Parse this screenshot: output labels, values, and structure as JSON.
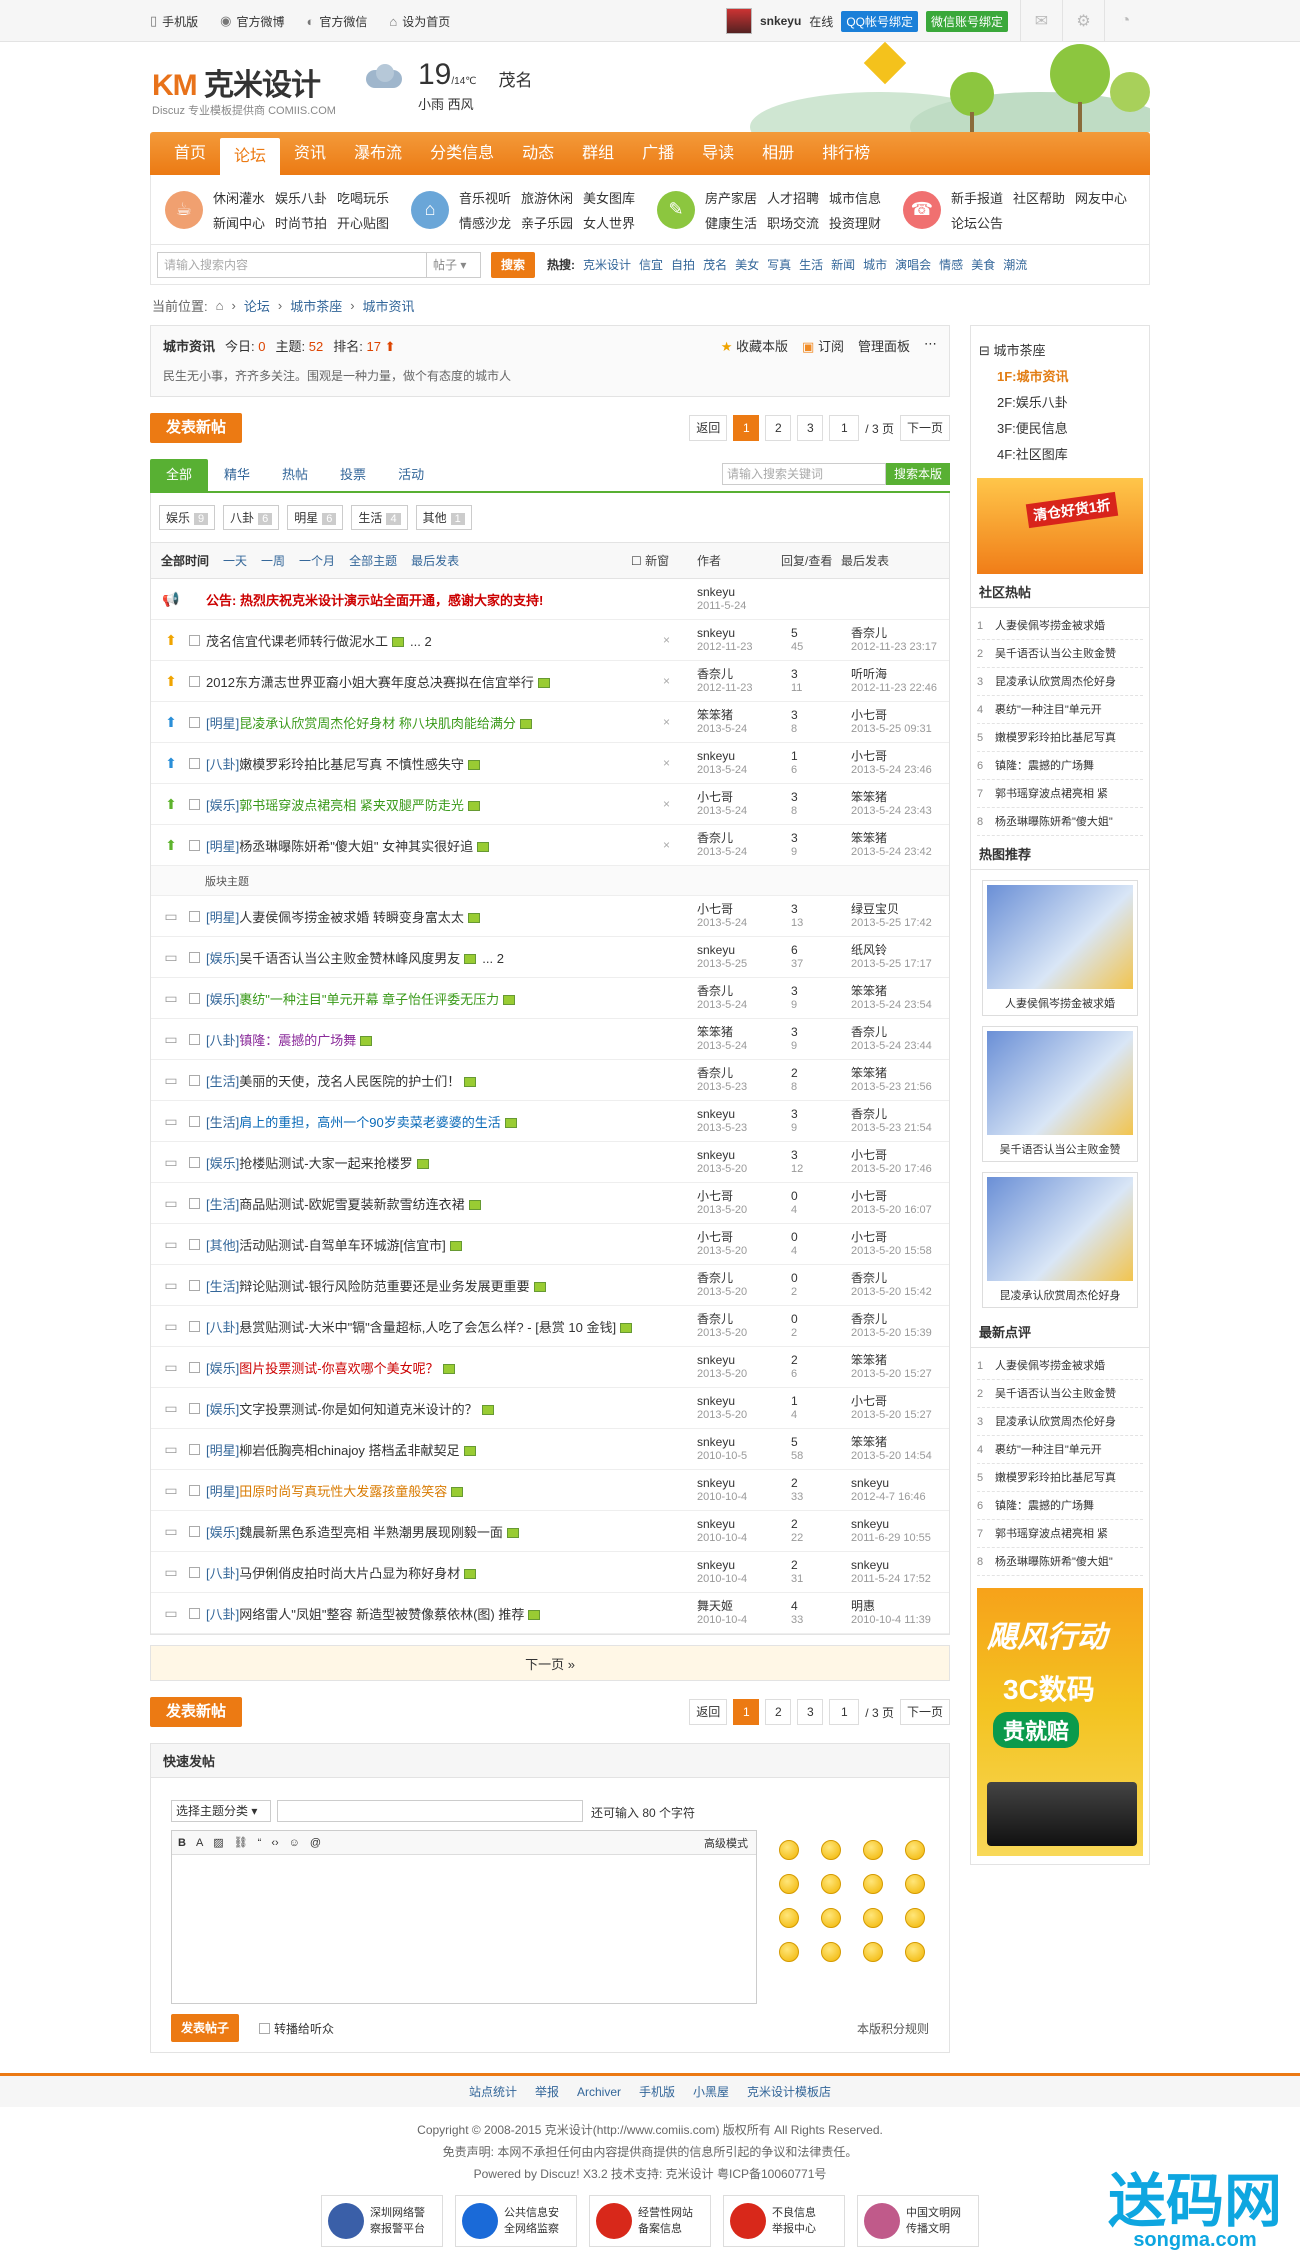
{
  "topbar": {
    "links": [
      "手机版",
      "官方微博",
      "官方微信",
      "设为首页"
    ],
    "user": "snkeyu",
    "status": "在线",
    "qq": "QQ帐号绑定",
    "wx": "微信账号绑定"
  },
  "logo": {
    "brand": "克米设计",
    "sub": "Discuz 专业模板提供商 COMIIS.COM"
  },
  "weather": {
    "temp": "19",
    "range": "/14℃",
    "city": "茂名",
    "desc": "小雨  西风"
  },
  "nav": [
    "首页",
    "论坛",
    "资讯",
    "瀑布流",
    "分类信息",
    "动态",
    "群组",
    "广播",
    "导读",
    "相册",
    "排行榜"
  ],
  "quick": [
    {
      "links": [
        "休闲灌水",
        "娱乐八卦",
        "吃喝玩乐",
        "新闻中心",
        "时尚节拍",
        "开心贴图"
      ],
      "color": "#f0a070"
    },
    {
      "links": [
        "音乐视听",
        "旅游休闲",
        "美女图库",
        "情感沙龙",
        "亲子乐园",
        "女人世界"
      ],
      "color": "#6aa6d8"
    },
    {
      "links": [
        "房产家居",
        "人才招聘",
        "城市信息",
        "健康生活",
        "职场交流",
        "投资理财"
      ],
      "color": "#8cc63f"
    },
    {
      "links": [
        "新手报道",
        "社区帮助",
        "网友中心",
        "论坛公告"
      ],
      "color": "#f07070"
    }
  ],
  "search": {
    "placeholder": "请输入搜索内容",
    "type": "帖子",
    "button": "搜索",
    "hot_label": "热搜:",
    "hot": [
      "克米设计",
      "信宜",
      "自拍",
      "茂名",
      "美女",
      "写真",
      "生活",
      "新闻",
      "城市",
      "演唱会",
      "情感",
      "美食",
      "潮流"
    ]
  },
  "crumb": {
    "label": "当前位置:",
    "items": [
      "论坛",
      "城市茶座",
      "城市资讯"
    ]
  },
  "forum": {
    "name": "城市资讯",
    "today_label": "今日:",
    "today": "0",
    "topics_label": "主题:",
    "topics": "52",
    "rank_label": "排名:",
    "rank": "17",
    "fav": "收藏本版",
    "rss": "订阅",
    "admin": "管理面板",
    "desc": "民生无小事，齐齐多关注。围观是一种力量，做个有态度的城市人"
  },
  "pager": {
    "post": "发表新帖",
    "back": "返回",
    "pages": [
      "1",
      "2",
      "3"
    ],
    "current": "1",
    "total": "/ 3 页",
    "next": "下一页"
  },
  "tabs": {
    "items": [
      "全部",
      "精华",
      "热帖",
      "投票",
      "活动"
    ],
    "search_placeholder": "请输入搜索关键词",
    "search_btn": "搜索本版"
  },
  "types": [
    {
      "name": "娱乐",
      "n": "9"
    },
    {
      "name": "八卦",
      "n": "6"
    },
    {
      "name": "明星",
      "n": "6"
    },
    {
      "name": "生活",
      "n": "4"
    },
    {
      "name": "其他",
      "n": "1"
    }
  ],
  "thead": {
    "sorts": [
      "全部时间",
      "一天",
      "一周",
      "一个月",
      "全部主题",
      "最后发表"
    ],
    "newwin": "新窗",
    "author": "作者",
    "reply": "回复/查看",
    "last": "最后发表"
  },
  "sep": "版块主题",
  "threads": [
    {
      "t": "公告: 热烈庆祝克米设计演示站全面开通，感谢大家的支持!",
      "a": "snkeyu",
      "ad": "2011-5-24",
      "r": "",
      "v": "",
      "l": "",
      "ld": "",
      "ann": true
    },
    {
      "t": "茂名信宜代课老师转行做泥水工",
      "a": "snkeyu",
      "ad": "2012-11-23",
      "r": "5",
      "v": "45",
      "l": "香奈儿",
      "ld": "2012-11-23 23:17",
      "pg": "... 2"
    },
    {
      "t": "2012东方潇志世界亚裔小姐大赛年度总决赛拟在信宜举行",
      "a": "香奈儿",
      "ad": "2012-11-23",
      "r": "3",
      "v": "11",
      "l": "听听海",
      "ld": "2012-11-23 22:46"
    },
    {
      "c": "[明星]",
      "t": "昆凌承认欣赏周杰伦好身材 称八块肌肉能给满分",
      "a": "笨笨猪",
      "ad": "2013-5-24",
      "r": "3",
      "v": "8",
      "l": "小七哥",
      "ld": "2013-5-25 09:31",
      "green": true
    },
    {
      "c": "[八卦]",
      "t": "嫩模罗彩玲拍比基尼写真 不慎性感失守",
      "a": "snkeyu",
      "ad": "2013-5-24",
      "r": "1",
      "v": "6",
      "l": "小七哥",
      "ld": "2013-5-24 23:46"
    },
    {
      "c": "[娱乐]",
      "t": "郭书瑶穿波点裙亮相 紧夹双腿严防走光",
      "a": "小七哥",
      "ad": "2013-5-24",
      "r": "3",
      "v": "8",
      "l": "笨笨猪",
      "ld": "2013-5-24 23:43",
      "green": true
    },
    {
      "c": "[明星]",
      "t": "杨丞琳曝陈妍希\"傻大姐\" 女神其实很好追",
      "a": "香奈儿",
      "ad": "2013-5-24",
      "r": "3",
      "v": "9",
      "l": "笨笨猪",
      "ld": "2013-5-24 23:42"
    },
    {
      "sep": true
    },
    {
      "c": "[明星]",
      "t": "人妻侯佩岑捞金被求婚 转瞬变身富太太",
      "a": "小七哥",
      "ad": "2013-5-24",
      "r": "3",
      "v": "13",
      "l": "绿豆宝贝",
      "ld": "2013-5-25 17:42"
    },
    {
      "c": "[娱乐]",
      "t": "吴千语否认当公主败金赞林峰风度男友",
      "a": "snkeyu",
      "ad": "2013-5-25",
      "r": "6",
      "v": "37",
      "l": "纸风铃",
      "ld": "2013-5-25 17:17",
      "pg": "... 2"
    },
    {
      "c": "[娱乐]",
      "t": "裹纺\"一种注目\"单元开幕 章子怡任评委无压力",
      "a": "香奈儿",
      "ad": "2013-5-24",
      "r": "3",
      "v": "9",
      "l": "笨笨猪",
      "ld": "2013-5-24 23:54",
      "green": true
    },
    {
      "c": "[八卦]",
      "t": "镇隆：震撼的广场舞",
      "a": "笨笨猪",
      "ad": "2013-5-24",
      "r": "3",
      "v": "9",
      "l": "香奈儿",
      "ld": "2013-5-24 23:44",
      "purple": true
    },
    {
      "c": "[生活]",
      "t": "美丽的天使，茂名人民医院的护士们！",
      "a": "香奈儿",
      "ad": "2013-5-23",
      "r": "2",
      "v": "8",
      "l": "笨笨猪",
      "ld": "2013-5-23 21:56"
    },
    {
      "c": "[生活]",
      "t": "肩上的重担，高州一个90岁卖菜老婆婆的生活",
      "a": "snkeyu",
      "ad": "2013-5-23",
      "r": "3",
      "v": "9",
      "l": "香奈儿",
      "ld": "2013-5-23 21:54",
      "blue": true
    },
    {
      "c": "[娱乐]",
      "t": "抢楼贴测试-大家一起来抢楼罗",
      "a": "snkeyu",
      "ad": "2013-5-20",
      "r": "3",
      "v": "12",
      "l": "小七哥",
      "ld": "2013-5-20 17:46"
    },
    {
      "c": "[生活]",
      "t": "商品贴测试-欧妮雪夏装新款雪纺连衣裙",
      "a": "小七哥",
      "ad": "2013-5-20",
      "r": "0",
      "v": "4",
      "l": "小七哥",
      "ld": "2013-5-20 16:07"
    },
    {
      "c": "[其他]",
      "t": "活动贴测试-自驾单车环城游[信宜市]",
      "a": "小七哥",
      "ad": "2013-5-20",
      "r": "0",
      "v": "4",
      "l": "小七哥",
      "ld": "2013-5-20 15:58"
    },
    {
      "c": "[生活]",
      "t": "辩论贴测试-银行风险防范重要还是业务发展更重要",
      "a": "香奈儿",
      "ad": "2013-5-20",
      "r": "0",
      "v": "2",
      "l": "香奈儿",
      "ld": "2013-5-20 15:42"
    },
    {
      "c": "[八卦]",
      "t": "悬赏贴测试-大米中\"镉\"含量超标,人吃了会怎么样? - [悬赏 10 金钱]",
      "a": "香奈儿",
      "ad": "2013-5-20",
      "r": "0",
      "v": "2",
      "l": "香奈儿",
      "ld": "2013-5-20 15:39"
    },
    {
      "c": "[娱乐]",
      "t": "图片投票测试-你喜欢哪个美女呢？",
      "a": "snkeyu",
      "ad": "2013-5-20",
      "r": "2",
      "v": "6",
      "l": "笨笨猪",
      "ld": "2013-5-20 15:27",
      "red": true
    },
    {
      "c": "[娱乐]",
      "t": "文字投票测试-你是如何知道克米设计的？",
      "a": "snkeyu",
      "ad": "2013-5-20",
      "r": "1",
      "v": "4",
      "l": "小七哥",
      "ld": "2013-5-20 15:27"
    },
    {
      "c": "[明星]",
      "t": "柳岩低胸亮相chinajoy 搭档孟非献契足",
      "a": "snkeyu",
      "ad": "2010-10-5",
      "r": "5",
      "v": "58",
      "l": "笨笨猪",
      "ld": "2013-5-20 14:54"
    },
    {
      "c": "[明星]",
      "t": "田原时尚写真玩性大发露孩童般笑容",
      "a": "snkeyu",
      "ad": "2010-10-4",
      "r": "2",
      "v": "33",
      "l": "snkeyu",
      "ld": "2012-4-7 16:46",
      "orange": true
    },
    {
      "c": "[娱乐]",
      "t": "魏晨新黑色系造型亮相 半熟潮男展现刚毅一面",
      "a": "snkeyu",
      "ad": "2010-10-4",
      "r": "2",
      "v": "22",
      "l": "snkeyu",
      "ld": "2011-6-29 10:55"
    },
    {
      "c": "[八卦]",
      "t": "马伊俐俏皮拍时尚大片凸显为称好身材",
      "a": "snkeyu",
      "ad": "2010-10-4",
      "r": "2",
      "v": "31",
      "l": "snkeyu",
      "ld": "2011-5-24 17:52"
    },
    {
      "c": "[八卦]",
      "t": "网络雷人\"凤姐\"整容 新造型被赞像蔡依林(图) 推荐",
      "a": "舞天姬",
      "ad": "2010-10-4",
      "r": "4",
      "v": "33",
      "l": "明惠",
      "ld": "2010-10-4 11:39"
    }
  ],
  "nextpage": "下一页 »",
  "quickpost": {
    "title": "快速发帖",
    "sel": "选择主题分类",
    "limit": "还可输入 80 个字符",
    "adv": "高级模式",
    "submit": "发表帖子",
    "sync": "转播给听众",
    "rule": "本版积分规则"
  },
  "right": {
    "tree": {
      "root": "城市茶座",
      "items": [
        "1F:城市资讯",
        "2F:娱乐八卦",
        "3F:便民信息",
        "4F:社区图库"
      ]
    },
    "ad1": "清仓好货1折",
    "hot_title": "社区热帖",
    "hot": [
      "人妻侯佩岑捞金被求婚",
      "吴千语否认当公主败金赞",
      "昆凌承认欣赏周杰伦好身",
      "裹纺\"一种注目\"单元开",
      "嫩模罗彩玲拍比基尼写真",
      "镇隆：震撼的广场舞",
      "郭书瑶穿波点裙亮相 紧",
      "杨丞琳曝陈妍希\"傻大姐\""
    ],
    "rec_title": "热图推荐",
    "pics": [
      "人妻侯佩岑捞金被求婚",
      "吴千语否认当公主败金赞",
      "昆凌承认欣赏周杰伦好身"
    ],
    "cmt_title": "最新点评",
    "cmt": [
      "人妻侯佩岑捞金被求婚",
      "吴千语否认当公主败金赞",
      "昆凌承认欣赏周杰伦好身",
      "裹纺\"一种注目\"单元开",
      "嫩模罗彩玲拍比基尼写真",
      "镇隆：震撼的广场舞",
      "郭书瑶穿波点裙亮相 紧",
      "杨丞琳曝陈妍希\"傻大姐\""
    ],
    "ad2": {
      "t1": "飓风行动",
      "t2": "3C数码",
      "t3": "贵就赔"
    }
  },
  "footer": {
    "links": [
      "站点统计",
      "举报",
      "Archiver",
      "手机版",
      "小黑屋",
      "克米设计模板店"
    ],
    "lines": [
      "Copyright © 2008-2015 克米设计(http://www.comiis.com) 版权所有 All Rights Reserved.",
      "免责声明: 本网不承担任何由内容提供商提供的信息所引起的争议和法律责任。",
      "Powered by Discuz! X3.2  技术支持: 克米设计  粤ICP备10060771号"
    ],
    "badges": [
      [
        "深圳网络警",
        "察报警平台"
      ],
      [
        "公共信息安",
        "全网络监察"
      ],
      [
        "经营性网站",
        "备案信息"
      ],
      [
        "不良信息",
        "举报中心"
      ],
      [
        "中国文明网",
        "传播文明"
      ]
    ]
  },
  "watermark": {
    "big": "送码网",
    "small": "songma.com"
  }
}
